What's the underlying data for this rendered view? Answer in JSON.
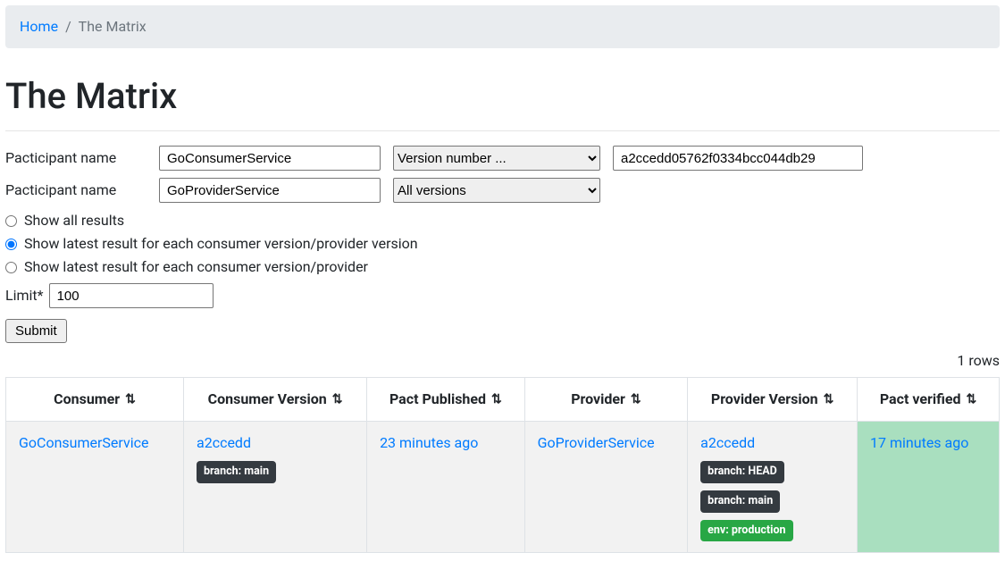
{
  "breadcrumb": {
    "home": "Home",
    "sep": "/",
    "current": "The Matrix"
  },
  "title": "The Matrix",
  "form": {
    "pacticipant_label": "Pacticipant name",
    "rows": [
      {
        "name": "GoConsumerService",
        "selector": "Version number ...",
        "version_value": "a2ccedd05762f0334bcc044db29"
      },
      {
        "name": "GoProviderService",
        "selector": "All versions",
        "version_value": ""
      }
    ],
    "radios": {
      "all": "Show all results",
      "latest_cv_pv": "Show latest result for each consumer version/provider version",
      "latest_cv_p": "Show latest result for each consumer version/provider"
    },
    "limit_label": "Limit*",
    "limit_value": "100",
    "submit_label": "Submit"
  },
  "rows_label": "1 rows",
  "table": {
    "headers": {
      "consumer": "Consumer",
      "consumer_version": "Consumer Version",
      "pact_published": "Pact Published",
      "provider": "Provider",
      "provider_version": "Provider Version",
      "pact_verified": "Pact verified"
    },
    "row": {
      "consumer": "GoConsumerService",
      "consumer_version": "a2ccedd",
      "consumer_badges": [
        "branch: main"
      ],
      "pact_published": "23 minutes ago",
      "provider": "GoProviderService",
      "provider_version": "a2ccedd",
      "provider_badges_dark": [
        "branch: HEAD",
        "branch: main"
      ],
      "provider_badges_green": [
        "env: production"
      ],
      "pact_verified": "17 minutes ago"
    }
  }
}
